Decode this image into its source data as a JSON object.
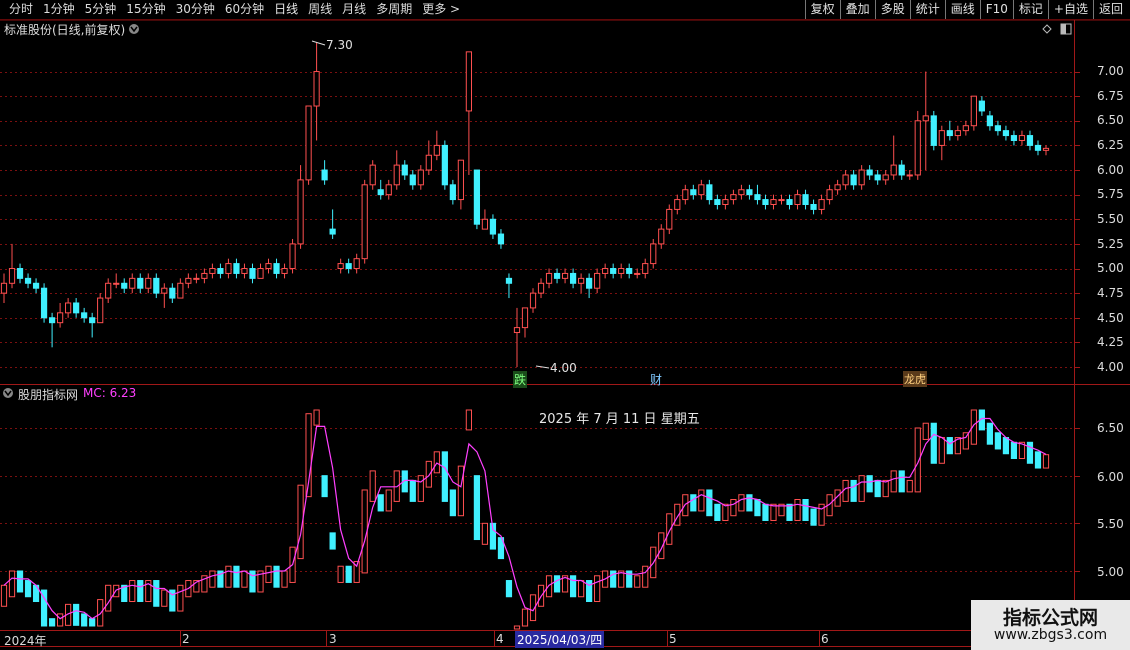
{
  "toolbar": {
    "periods": [
      "分时",
      "1分钟",
      "5分钟",
      "15分钟",
      "30分钟",
      "60分钟",
      "日线",
      "周线",
      "月线",
      "多周期",
      "更多 >"
    ],
    "actions": [
      "复权",
      "叠加",
      "多股",
      "统计",
      "画线",
      "F10",
      "标记",
      "+自选",
      "返回"
    ]
  },
  "main_title": "标准股份(日线,前复权)",
  "main_axis": [
    "7.00",
    "6.75",
    "6.50",
    "6.25",
    "6.00",
    "5.75",
    "5.50",
    "5.25",
    "5.00",
    "4.75",
    "4.50",
    "4.25",
    "4.00"
  ],
  "max_label": "7.30",
  "min_label": "4.00",
  "markers": {
    "m1": "跌",
    "m2": "财",
    "m3": "龙虎"
  },
  "indicator": {
    "name": "股朋指标网",
    "mc_label": "MC: 6.23",
    "date_tip": "2025 年 7 月 11 日 星期五"
  },
  "indicator_axis": [
    "6.50",
    "6.00",
    "5.50",
    "5.00"
  ],
  "time_axis": {
    "labels": [
      "2024年",
      "2",
      "3",
      "4",
      "5",
      "6"
    ],
    "highlight": "2025/04/03/四"
  },
  "watermark": {
    "line1": "指标公式网",
    "line2": "www.zbgs3.com"
  },
  "colors": {
    "up": "#ff5050",
    "down": "#40f0ff",
    "ma": "#ff40ff",
    "grid": "#7a1010",
    "frame": "#a01818"
  },
  "chart_data": {
    "type": "candlestick",
    "ylim": [
      3.95,
      7.35
    ],
    "indicator_ylim": [
      4.6,
      6.95
    ],
    "candles": [
      [
        4.75,
        4.85,
        4.65,
        4.95
      ],
      [
        4.85,
        5.0,
        4.8,
        5.25
      ],
      [
        5.0,
        4.9,
        4.85,
        5.05
      ],
      [
        4.9,
        4.85,
        4.8,
        4.95
      ],
      [
        4.85,
        4.8,
        4.75,
        4.9
      ],
      [
        4.8,
        4.5,
        4.45,
        4.85
      ],
      [
        4.5,
        4.45,
        4.2,
        4.55
      ],
      [
        4.45,
        4.55,
        4.4,
        4.65
      ],
      [
        4.55,
        4.65,
        4.5,
        4.7
      ],
      [
        4.65,
        4.55,
        4.5,
        4.7
      ],
      [
        4.55,
        4.5,
        4.45,
        4.6
      ],
      [
        4.5,
        4.45,
        4.3,
        4.55
      ],
      [
        4.45,
        4.7,
        4.45,
        4.75
      ],
      [
        4.7,
        4.85,
        4.65,
        4.9
      ],
      [
        4.85,
        4.85,
        4.8,
        4.95
      ],
      [
        4.85,
        4.8,
        4.75,
        4.9
      ],
      [
        4.8,
        4.9,
        4.75,
        4.95
      ],
      [
        4.9,
        4.8,
        4.75,
        4.95
      ],
      [
        4.8,
        4.9,
        4.75,
        4.95
      ],
      [
        4.9,
        4.75,
        4.7,
        4.95
      ],
      [
        4.75,
        4.8,
        4.6,
        4.85
      ],
      [
        4.8,
        4.7,
        4.65,
        4.85
      ],
      [
        4.7,
        4.85,
        4.7,
        4.9
      ],
      [
        4.85,
        4.9,
        4.8,
        4.95
      ],
      [
        4.9,
        4.9,
        4.85,
        4.95
      ],
      [
        4.9,
        4.95,
        4.85,
        5.0
      ],
      [
        4.95,
        5.0,
        4.9,
        5.05
      ],
      [
        5.0,
        4.95,
        4.9,
        5.05
      ],
      [
        4.95,
        5.05,
        4.9,
        5.1
      ],
      [
        5.05,
        4.95,
        4.9,
        5.1
      ],
      [
        4.95,
        5.0,
        4.9,
        5.05
      ],
      [
        5.0,
        4.9,
        4.85,
        5.05
      ],
      [
        4.9,
        5.0,
        4.9,
        5.05
      ],
      [
        5.0,
        5.05,
        4.95,
        5.1
      ],
      [
        5.05,
        4.95,
        4.9,
        5.1
      ],
      [
        4.95,
        5.0,
        4.9,
        5.05
      ],
      [
        5.0,
        5.25,
        4.95,
        5.3
      ],
      [
        5.25,
        5.9,
        5.2,
        6.05
      ],
      [
        5.9,
        6.65,
        5.85,
        6.65
      ],
      [
        6.65,
        7.0,
        6.3,
        7.3
      ],
      [
        6.0,
        5.9,
        5.85,
        6.1
      ],
      [
        5.4,
        5.35,
        5.3,
        5.6
      ],
      [
        5.0,
        5.05,
        4.95,
        5.1
      ],
      [
        5.05,
        5.0,
        4.95,
        5.1
      ],
      [
        5.0,
        5.1,
        4.95,
        5.15
      ],
      [
        5.1,
        5.85,
        5.05,
        5.9
      ],
      [
        5.85,
        6.05,
        5.8,
        6.1
      ],
      [
        5.8,
        5.75,
        5.7,
        5.9
      ],
      [
        5.75,
        5.85,
        5.7,
        5.9
      ],
      [
        5.85,
        6.05,
        5.8,
        6.2
      ],
      [
        6.05,
        5.95,
        5.9,
        6.1
      ],
      [
        5.95,
        5.85,
        5.8,
        6.0
      ],
      [
        5.85,
        6.0,
        5.8,
        6.05
      ],
      [
        6.0,
        6.15,
        5.95,
        6.3
      ],
      [
        6.15,
        6.25,
        6.1,
        6.4
      ],
      [
        6.25,
        5.85,
        5.8,
        6.3
      ],
      [
        5.85,
        5.7,
        5.65,
        5.9
      ],
      [
        5.7,
        6.1,
        5.6,
        6.1
      ],
      [
        6.6,
        7.2,
        5.95,
        7.2
      ],
      [
        6.0,
        5.45,
        5.4,
        6.0
      ],
      [
        5.4,
        5.5,
        5.4,
        5.6
      ],
      [
        5.5,
        5.35,
        5.3,
        5.55
      ],
      [
        5.35,
        5.25,
        5.2,
        5.4
      ],
      [
        4.9,
        4.85,
        4.7,
        4.95
      ],
      [
        4.35,
        4.4,
        4.0,
        4.6
      ],
      [
        4.4,
        4.6,
        4.3,
        4.6
      ],
      [
        4.6,
        4.75,
        4.55,
        4.8
      ],
      [
        4.75,
        4.85,
        4.7,
        4.9
      ],
      [
        4.85,
        4.95,
        4.8,
        5.0
      ],
      [
        4.95,
        4.9,
        4.85,
        5.0
      ],
      [
        4.9,
        4.95,
        4.85,
        5.0
      ],
      [
        4.95,
        4.85,
        4.8,
        5.0
      ],
      [
        4.85,
        4.9,
        4.75,
        4.95
      ],
      [
        4.9,
        4.8,
        4.7,
        4.95
      ],
      [
        4.8,
        4.95,
        4.75,
        5.0
      ],
      [
        4.95,
        5.0,
        4.9,
        5.05
      ],
      [
        5.0,
        4.95,
        4.9,
        5.05
      ],
      [
        4.95,
        5.0,
        4.9,
        5.05
      ],
      [
        5.0,
        4.95,
        4.9,
        5.05
      ],
      [
        4.95,
        4.95,
        4.9,
        5.0
      ],
      [
        4.95,
        5.05,
        4.9,
        5.1
      ],
      [
        5.05,
        5.25,
        5.0,
        5.3
      ],
      [
        5.25,
        5.4,
        5.2,
        5.45
      ],
      [
        5.4,
        5.6,
        5.35,
        5.65
      ],
      [
        5.6,
        5.7,
        5.55,
        5.75
      ],
      [
        5.7,
        5.8,
        5.65,
        5.85
      ],
      [
        5.8,
        5.75,
        5.7,
        5.85
      ],
      [
        5.75,
        5.85,
        5.7,
        5.9
      ],
      [
        5.85,
        5.7,
        5.65,
        5.9
      ],
      [
        5.7,
        5.65,
        5.6,
        5.75
      ],
      [
        5.65,
        5.7,
        5.6,
        5.75
      ],
      [
        5.7,
        5.75,
        5.65,
        5.8
      ],
      [
        5.75,
        5.8,
        5.7,
        5.85
      ],
      [
        5.8,
        5.75,
        5.7,
        5.85
      ],
      [
        5.75,
        5.7,
        5.65,
        5.85
      ],
      [
        5.7,
        5.65,
        5.6,
        5.75
      ],
      [
        5.65,
        5.7,
        5.6,
        5.75
      ],
      [
        5.7,
        5.7,
        5.65,
        5.75
      ],
      [
        5.7,
        5.65,
        5.6,
        5.75
      ],
      [
        5.65,
        5.75,
        5.6,
        5.8
      ],
      [
        5.75,
        5.65,
        5.6,
        5.8
      ],
      [
        5.65,
        5.6,
        5.55,
        5.7
      ],
      [
        5.6,
        5.7,
        5.55,
        5.75
      ],
      [
        5.7,
        5.8,
        5.65,
        5.85
      ],
      [
        5.8,
        5.85,
        5.75,
        5.9
      ],
      [
        5.85,
        5.95,
        5.8,
        6.0
      ],
      [
        5.95,
        5.85,
        5.8,
        6.0
      ],
      [
        5.85,
        6.0,
        5.8,
        6.05
      ],
      [
        6.0,
        5.95,
        5.9,
        6.05
      ],
      [
        5.95,
        5.9,
        5.85,
        6.0
      ],
      [
        5.9,
        5.95,
        5.85,
        6.0
      ],
      [
        5.95,
        6.05,
        5.9,
        6.35
      ],
      [
        6.05,
        5.95,
        5.9,
        6.1
      ],
      [
        5.95,
        5.95,
        5.9,
        6.0
      ],
      [
        5.95,
        6.5,
        5.9,
        6.6
      ],
      [
        6.5,
        6.55,
        6.0,
        7.0
      ],
      [
        6.55,
        6.25,
        6.2,
        6.6
      ],
      [
        6.25,
        6.4,
        6.1,
        6.45
      ],
      [
        6.4,
        6.35,
        6.3,
        6.5
      ],
      [
        6.35,
        6.4,
        6.3,
        6.45
      ],
      [
        6.4,
        6.45,
        6.35,
        6.5
      ],
      [
        6.45,
        6.75,
        6.4,
        6.75
      ],
      [
        6.7,
        6.6,
        6.55,
        6.75
      ],
      [
        6.55,
        6.45,
        6.4,
        6.6
      ],
      [
        6.45,
        6.4,
        6.35,
        6.5
      ],
      [
        6.4,
        6.35,
        6.3,
        6.45
      ],
      [
        6.35,
        6.3,
        6.25,
        6.4
      ],
      [
        6.3,
        6.35,
        6.25,
        6.4
      ],
      [
        6.35,
        6.25,
        6.2,
        6.4
      ],
      [
        6.25,
        6.2,
        6.15,
        6.3
      ],
      [
        6.2,
        6.22,
        6.15,
        6.25
      ]
    ]
  }
}
